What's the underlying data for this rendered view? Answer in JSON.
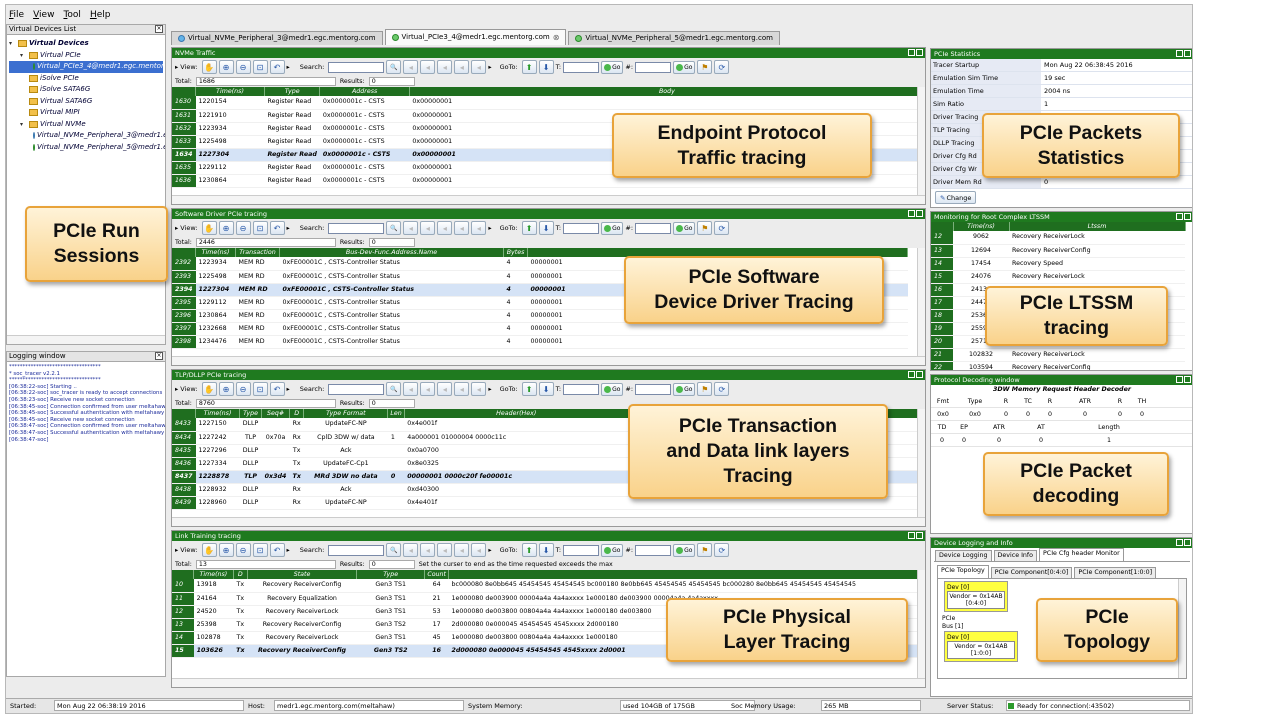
{
  "menu": [
    "File",
    "View",
    "Tool",
    "Help"
  ],
  "left": {
    "devices_title": "Virtual Devices List",
    "tree": [
      {
        "label": "Virtual Devices",
        "kind": "folder",
        "indent": 0,
        "bold": true
      },
      {
        "label": "Virtual PCIe",
        "kind": "folder",
        "indent": 1
      },
      {
        "label": "Virtual_PCIe3_4@medr1.egc.mentorg.com",
        "kind": "dot-green",
        "indent": 2,
        "selected": true
      },
      {
        "label": "iSolve PCIe",
        "kind": "folder",
        "indent": 1
      },
      {
        "label": "iSolve SATA6G",
        "kind": "folder",
        "indent": 1
      },
      {
        "label": "Virtual SATA6G",
        "kind": "folder",
        "indent": 1
      },
      {
        "label": "Virtual MIPI",
        "kind": "folder",
        "indent": 1
      },
      {
        "label": "Virtual NVMe",
        "kind": "folder",
        "indent": 1
      },
      {
        "label": "Virtual_NVMe_Peripheral_3@medr1.egc.mentorg.com",
        "kind": "dot-blue",
        "indent": 2
      },
      {
        "label": "Virtual_NVMe_Peripheral_5@medr1.egc.mentorg.com",
        "kind": "dot-green",
        "indent": 2
      }
    ],
    "logging_title": "Logging window",
    "log": [
      "**********************************",
      "*      soc_tracer v2.2.1",
      "**********************************",
      "[06:38:22-soc] Starting ..",
      "[06:38:22-soc] soc_tracer is ready to accept connections",
      "[06:38:23-soc] Receive new socket connection",
      "[06:38:45-soc] Connection confirmed from user meltahawy",
      "[06:38:45-soc] Successful authentication with meltahawy",
      "[06:38:45-soc] Receive new socket connection",
      "[06:38:47-soc] Connection confirmed from user meltahawy",
      "[06:38:47-soc] Successful authentication with meltahawy",
      "[06:38:47-soc]"
    ]
  },
  "tabs": [
    {
      "label": "Virtual_NVMe_Peripheral_3@medr1.egc.mentorg.com",
      "active": false
    },
    {
      "label": "Virtual_PCIe3_4@medr1.egc.mentorg.com",
      "active": true
    },
    {
      "label": "Virtual_NVMe_Peripheral_5@medr1.egc.mentorg.com",
      "active": false
    }
  ],
  "toolbar": {
    "view": "View:",
    "search": "Search:",
    "goto": "GoTo:",
    "t": "T:",
    "go": "Go",
    "hash": "#:",
    "total": "Total:",
    "results": "Results:",
    "results_val": "0"
  },
  "panes": [
    {
      "title": "NVMe Traffic",
      "total": "1686",
      "cols": [
        "Time(ns)",
        "Type",
        "Address",
        "Body"
      ],
      "widths": [
        70,
        48,
        90,
        530
      ],
      "rows": [
        [
          "1630",
          "1220154",
          "Register Read",
          "0x0000001c - CSTS",
          "0x00000001"
        ],
        [
          "1631",
          "1221910",
          "Register Read",
          "0x0000001c - CSTS",
          "0x00000001"
        ],
        [
          "1632",
          "1223934",
          "Register Read",
          "0x0000001c - CSTS",
          "0x00000001"
        ],
        [
          "1633",
          "1225498",
          "Register Read",
          "0x0000001c - CSTS",
          "0x00000001"
        ],
        [
          "1634",
          "1227304",
          "Register Read",
          "0x0000001c - CSTS",
          "0x00000001"
        ],
        [
          "1635",
          "1229112",
          "Register Read",
          "0x0000001c - CSTS",
          "0x00000001"
        ],
        [
          "1636",
          "1230864",
          "Register Read",
          "0x0000001c - CSTS",
          "0x00000001"
        ]
      ],
      "sel": 4
    },
    {
      "title": "Software Driver PCIe tracing",
      "total": "2446",
      "cols": [
        "Time(ns)",
        "Transaction",
        "Bus-Dev-Func.Address.Name",
        "Bytes",
        ""
      ],
      "widths": [
        40,
        44,
        224,
        24,
        380
      ],
      "rows": [
        [
          "2392",
          "1223934",
          "MEM RD",
          "0xFE00001C , CSTS-Controller Status",
          "4",
          "00000001"
        ],
        [
          "2393",
          "1225498",
          "MEM RD",
          "0xFE00001C , CSTS-Controller Status",
          "4",
          "00000001"
        ],
        [
          "2394",
          "1227304",
          "MEM RD",
          "0xFE00001C , CSTS-Controller Status",
          "4",
          "00000001"
        ],
        [
          "2395",
          "1229112",
          "MEM RD",
          "0xFE00001C , CSTS-Controller Status",
          "4",
          "00000001"
        ],
        [
          "2396",
          "1230864",
          "MEM RD",
          "0xFE00001C , CSTS-Controller Status",
          "4",
          "00000001"
        ],
        [
          "2397",
          "1232668",
          "MEM RD",
          "0xFE00001C , CSTS-Controller Status",
          "4",
          "00000001"
        ],
        [
          "2398",
          "1234476",
          "MEM RD",
          "0xFE00001C , CSTS-Controller Status",
          "4",
          "00000001"
        ]
      ],
      "sel": 2
    },
    {
      "title": "TLP/DLLP PCIe tracing",
      "total": "8760",
      "cols": [
        "Time(ns)",
        "Type",
        "Seq#",
        "D",
        "Type Format",
        "Len",
        "Header(Hex)",
        ""
      ],
      "widths": [
        44,
        22,
        28,
        14,
        84,
        16,
        224,
        296
      ],
      "rows": [
        [
          "8433",
          "1227150",
          "DLLP",
          "",
          "Rx",
          "UpdateFC-NP",
          "",
          "0x4e001f",
          ""
        ],
        [
          "8434",
          "1227242",
          "TLP",
          "0x70a",
          "Rx",
          "CplD 3DW w/ data",
          "1",
          "4a000001 01000004 0000c11c",
          "00000001"
        ],
        [
          "8435",
          "1227296",
          "DLLP",
          "",
          "Tx",
          "Ack",
          "",
          "0x0a0700",
          ""
        ],
        [
          "8436",
          "1227334",
          "DLLP",
          "",
          "Tx",
          "UpdateFC-Cp1",
          "",
          "0x8e0325",
          ""
        ],
        [
          "8437",
          "1228878",
          "TLP",
          "0x3d4",
          "Tx",
          "MRd 3DW no data",
          "0",
          "00000001 0000c20f fe00001c",
          ""
        ],
        [
          "8438",
          "1228932",
          "DLLP",
          "",
          "Rx",
          "Ack",
          "",
          "0xd40300",
          ""
        ],
        [
          "8439",
          "1228960",
          "DLLP",
          "",
          "Rx",
          "UpdateFC-NP",
          "",
          "0x4e401f",
          ""
        ]
      ],
      "sel": 4
    },
    {
      "title": "Link Training tracing",
      "total": "13",
      "note": "Set the curser to end as the time requested exceeds the max",
      "cols": [
        "Time(ns)",
        "D",
        "State",
        "Type",
        "Count",
        ""
      ],
      "widths": [
        40,
        14,
        110,
        70,
        22,
        480
      ],
      "rows": [
        [
          "10",
          "13918",
          "Tx",
          "Recovery ReceiverConfig",
          "Gen3 TS1",
          "64",
          "bc000080 8e0bb645 45454545 45454545   bc000180 8e0bb645 45454545 45454545   bc000280 8e0bb645 45454545 45454545"
        ],
        [
          "11",
          "24164",
          "Tx",
          "Recovery Equalization",
          "Gen3 TS1",
          "21",
          "1e000080 de003900 00004a4a 4a4axxxx   1e000180 de003900 00004a4a 4a4axxxx"
        ],
        [
          "12",
          "24520",
          "Tx",
          "Recovery ReceiverLock",
          "Gen3 TS1",
          "53",
          "1e000080 de003800 00804a4a 4a4axxxx   1e000180 de003800"
        ],
        [
          "13",
          "25398",
          "Tx",
          "Recovery ReceiverConfig",
          "Gen3 TS2",
          "17",
          "2d000080 0e000045 45454545 4545xxxx   2d000180"
        ],
        [
          "14",
          "102878",
          "Tx",
          "Recovery ReceiverLock",
          "Gen3 TS1",
          "45",
          "1e000080 de003800 00804a4a 4a4axxxx   1e000180"
        ],
        [
          "15",
          "103626",
          "Tx",
          "Recovery ReceiverConfig",
          "Gen3 TS2",
          "16",
          "2d000080 0e000045 45454545 4545xxxx   2d0001"
        ]
      ],
      "sel": 5
    }
  ],
  "stats": {
    "title": "PCIe Statistics",
    "rows": [
      [
        "Tracer Startup",
        "Mon Aug 22 06:38:45 2016"
      ],
      [
        "Emulation Sim Time",
        "19 sec"
      ],
      [
        "Emulation Time",
        "2004 ns"
      ],
      [
        "Sim Ratio",
        "1"
      ],
      [
        "Driver Tracing",
        ""
      ],
      [
        "TLP Tracing",
        ""
      ],
      [
        "DLLP Tracing",
        ""
      ],
      [
        "Driver Cfg Rd",
        ""
      ],
      [
        "Driver Cfg Wr",
        ""
      ],
      [
        "Driver Mem Rd",
        "0"
      ]
    ],
    "change": "Change"
  },
  "ltssm": {
    "title": "Monitoring for Root Complex LTSSM",
    "cols": [
      "Time(ns)",
      "Ltssm"
    ],
    "rows": [
      [
        "12",
        "9062",
        "Recovery ReceiverLock"
      ],
      [
        "13",
        "12694",
        "Recovery ReceiverConfig"
      ],
      [
        "14",
        "17454",
        "Recovery Speed"
      ],
      [
        "15",
        "24076",
        "Recovery ReceiverLock"
      ],
      [
        "16",
        "24134",
        "Recovery Equalization"
      ],
      [
        "17",
        "24471",
        ""
      ],
      [
        "18",
        "25363",
        ""
      ],
      [
        "19",
        "25599",
        ""
      ],
      [
        "20",
        "25712",
        ""
      ],
      [
        "21",
        "102832",
        "Recovery ReceiverLock"
      ],
      [
        "22",
        "103594",
        "Recovery ReceiverConfig"
      ]
    ]
  },
  "decoder": {
    "title": "Protocol Decoding window",
    "subtitle": "3DW Memory Request Header Decoder",
    "h1": [
      "Fmt",
      "Type",
      "R",
      "TC",
      "R",
      "ATR",
      "R",
      "TH"
    ],
    "v1": [
      "0x0",
      "0x0",
      "0",
      "0",
      "0",
      "0",
      "0",
      "0"
    ],
    "h2": [
      "TD",
      "EP",
      "ATR",
      "AT",
      "Length"
    ],
    "v2": [
      "0",
      "0",
      "0",
      "0",
      "1"
    ]
  },
  "devinfo": {
    "title": "Device Logging and Info",
    "tabs": [
      "Device Logging",
      "Device Info",
      "PCIe Cfg header Monitor"
    ],
    "subtabs": [
      "PCIe Topology",
      "PCIe Component[0:4:0]",
      "PCIe Component[1:0:0]"
    ],
    "dev0": "Dev [0]",
    "vendor1": "Vendor = 0x14AB",
    "bdf1": "[0:4:0]",
    "pcie": "PCIe",
    "bus": "Bus [1]",
    "dev1": "Dev [0]",
    "vendor2": "Vendor = 0x14AB",
    "bdf2": "[1:0:0]"
  },
  "status": {
    "started_label": "Started:",
    "started": "Mon Aug 22 06:38:19 2016",
    "host_label": "Host:",
    "host": "medr1.egc.mentorg.com(meltahaw)",
    "mem_label": "System Memory:",
    "mem": "used 104GB of 175GB",
    "soc_label": "Soc Memory Usage:",
    "soc": "265 MB",
    "server_label": "Server Status:",
    "server": "Ready for connection(:43502)"
  },
  "callouts": {
    "run": "PCIe Run\nSessions",
    "endpoint": "Endpoint Protocol\nTraffic tracing",
    "packets": "PCIe Packets\nStatistics",
    "driver": "PCIe Software\nDevice Driver Tracing",
    "ltssm": "PCIe LTSSM\ntracing",
    "tlp": "PCIe Transaction\nand Data link layers\nTracing",
    "decode": "PCIe Packet\ndecoding",
    "phys": "PCIe Physical\nLayer Tracing",
    "topo": "PCIe\nTopology"
  },
  "colors": {
    "header_green": "#1f7a1f",
    "callout_border": "#e8a33a",
    "selected_row": "#d5e3f6"
  }
}
